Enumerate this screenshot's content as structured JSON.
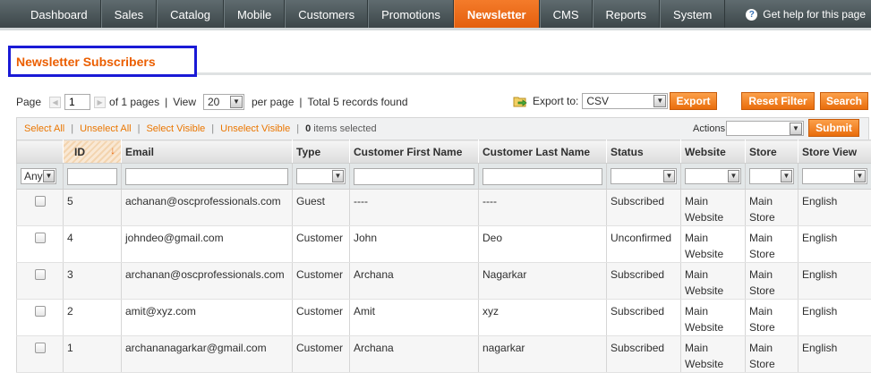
{
  "nav": {
    "items": [
      "Dashboard",
      "Sales",
      "Catalog",
      "Mobile",
      "Customers",
      "Promotions",
      "Newsletter",
      "CMS",
      "Reports",
      "System"
    ],
    "active": "Newsletter",
    "help": "Get help for this page"
  },
  "page": {
    "title": "Newsletter Subscribers"
  },
  "pager": {
    "page_label": "Page",
    "page_value": "1",
    "of_pages": "of 1 pages",
    "view_label": "View",
    "per_page": "20",
    "per_page_label": "per page",
    "total": "Total 5 records found",
    "sep": "|"
  },
  "export": {
    "label": "Export to:",
    "format": "CSV",
    "button": "Export"
  },
  "buttons": {
    "reset_filter": "Reset Filter",
    "search": "Search",
    "submit": "Submit"
  },
  "massaction": {
    "select_all": "Select All",
    "unselect_all": "Unselect All",
    "select_visible": "Select Visible",
    "unselect_visible": "Unselect Visible",
    "selected_count": "0",
    "selected_suffix": "items selected",
    "actions_label": "Actions",
    "actions_value": ""
  },
  "grid": {
    "columns": [
      "ID",
      "Email",
      "Type",
      "Customer First Name",
      "Customer Last Name",
      "Status",
      "Website",
      "Store",
      "Store View"
    ],
    "filter_any": "Any",
    "rows": [
      [
        "5",
        "achanan@oscprofessionals.com",
        "Guest",
        "----",
        "----",
        "Subscribed",
        "Main Website",
        "Main Store",
        "English"
      ],
      [
        "4",
        "johndeo@gmail.com",
        "Customer",
        "John",
        "Deo",
        "Unconfirmed",
        "Main Website",
        "Main Store",
        "English"
      ],
      [
        "3",
        "archanan@oscprofessionals.com",
        "Customer",
        "Archana",
        "Nagarkar",
        "Subscribed",
        "Main Website",
        "Main Store",
        "English"
      ],
      [
        "2",
        "amit@xyz.com",
        "Customer",
        "Amit",
        "xyz",
        "Subscribed",
        "Main Website",
        "Main Store",
        "English"
      ],
      [
        "1",
        "archananagarkar@gmail.com",
        "Customer",
        "Archana",
        "nagarkar",
        "Subscribed",
        "Main Website",
        "Main Store",
        "English"
      ]
    ]
  },
  "colors": {
    "accent": "#eb5e00",
    "nav_bg": "#4a5558",
    "highlight_box": "#1a1ad6"
  },
  "icons": {
    "help": "help-icon",
    "export": "export-icon",
    "sort": "sort-desc-icon"
  }
}
